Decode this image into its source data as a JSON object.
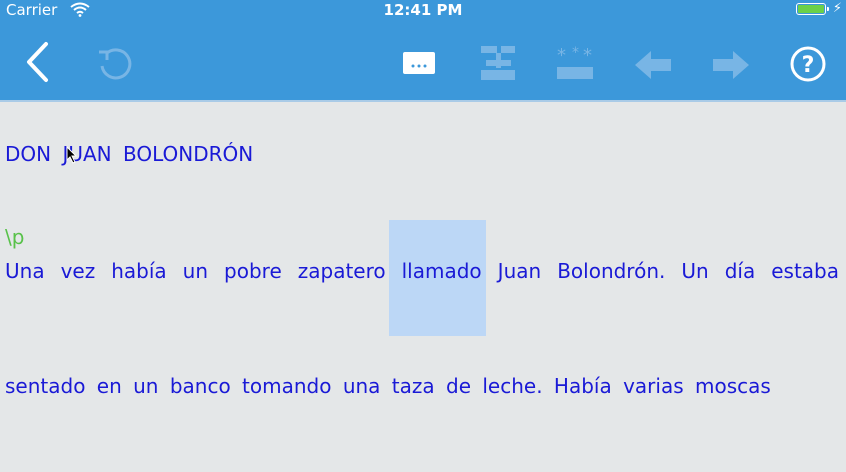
{
  "status": {
    "carrier": "Carrier",
    "time": "12:41 PM",
    "battery_level": 1.0
  },
  "toolbar": {
    "buttons": [
      {
        "name": "back",
        "icon": "chevron-left-icon",
        "enabled": true
      },
      {
        "name": "refresh",
        "icon": "refresh-icon",
        "enabled": false
      },
      {
        "name": "more",
        "icon": "ellipsis-box-icon",
        "enabled": true
      },
      {
        "name": "structure",
        "icon": "tree-structure-icon",
        "enabled": false
      },
      {
        "name": "markers",
        "icon": "asterisk-markers-icon",
        "enabled": false
      },
      {
        "name": "previous",
        "icon": "arrow-left-icon",
        "enabled": false
      },
      {
        "name": "next",
        "icon": "arrow-right-icon",
        "enabled": false
      },
      {
        "name": "help",
        "icon": "help-circle-icon",
        "enabled": true
      }
    ]
  },
  "document": {
    "title_line": "DON JUAN BOLONDRÓN",
    "marker": "\\p",
    "line1_words": [
      "Una",
      "vez",
      "había",
      "un",
      "pobre",
      "zapatero",
      "llamado",
      "Juan",
      "Bolondrón.",
      "Un",
      "día",
      "estaba"
    ],
    "highlighted_word": "llamado",
    "line2": "sentado en un banco tomando una taza de leche. Había varias moscas"
  },
  "colors": {
    "bar": "#3c98da",
    "text": "#1a1ad6",
    "marker": "#58c24a",
    "highlight": "#bcd7f6",
    "background": "#e4e7e8"
  }
}
